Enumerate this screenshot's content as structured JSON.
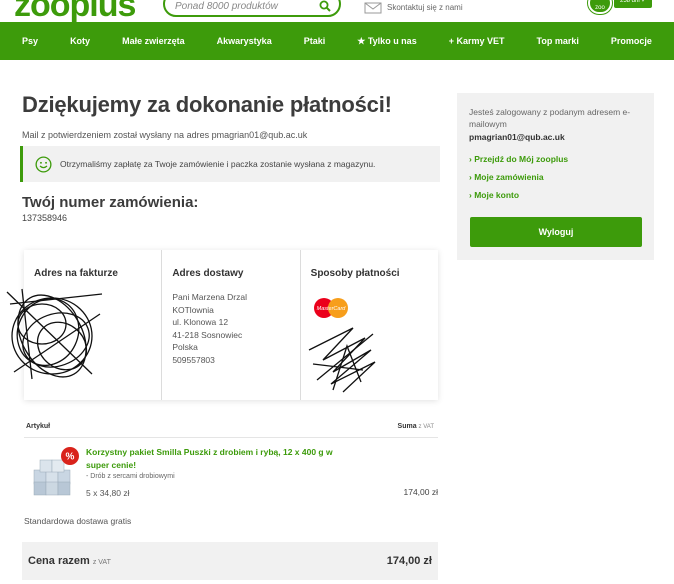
{
  "header": {
    "logo": "zooplus",
    "search_placeholder": "Ponad 8000 produktów",
    "contact": "Skontaktuj się z nami",
    "badge_label": "258 dni ✓"
  },
  "nav": {
    "items": [
      "Psy",
      "Koty",
      "Małe zwierzęta",
      "Akwarystyka",
      "Ptaki",
      "★ Tylko u nas",
      "+ Karmy VET",
      "Top marki",
      "Promocje"
    ]
  },
  "main": {
    "title": "Dziękujemy za dokonanie płatności!",
    "mail_note": "Mail z potwierdzeniem został wysłany na adres pmagrian01@qub.ac.uk",
    "success_message": "Otrzymaliśmy zapłatę za Twoje zamówienie i paczka zostanie wysłana z magazynu.",
    "order_heading": "Twój numer zamówienia:",
    "order_number": "137358946"
  },
  "info": {
    "billing_title": "Adres na fakturze",
    "shipping_title": "Adres dostawy",
    "shipping_lines": [
      "Pani Marzena Drzal",
      "KOTlownia",
      "ul. Klonowa 12",
      "41-218 Sosnowiec",
      "Polska",
      "509557803"
    ],
    "payment_title": "Sposoby płatności",
    "card_logo": "MasterCard"
  },
  "items": {
    "col_article": "Artykuł",
    "col_sum": "Suma",
    "col_sum_note": "z VAT",
    "product_name": "Korzystny pakiet Smilla Puszki z drobiem i rybą, 12 x 400 g w super cenie!",
    "variant": "- Drób z sercami drobiowymi",
    "qty_price": "5 x 34,80 zł",
    "line_total": "174,00 zł",
    "sale_badge": "%"
  },
  "shipping_note": "Standardowa dostawa gratis",
  "total": {
    "label": "Cena razem",
    "note": "z VAT",
    "value": "174,00 zł"
  },
  "sidebar": {
    "logged_in_text": "Jesteś zalogowany z podanym adresem e-mailowym",
    "email": "pmagrian01@qub.ac.uk",
    "links": [
      "› Przejdź do Mój zooplus",
      "› Moje zamówienia",
      "› Moje konto"
    ],
    "logout_label": "Wyloguj"
  },
  "colors": {
    "brand_green": "#3d9b0b",
    "panel_gray": "#f1f1f1"
  }
}
